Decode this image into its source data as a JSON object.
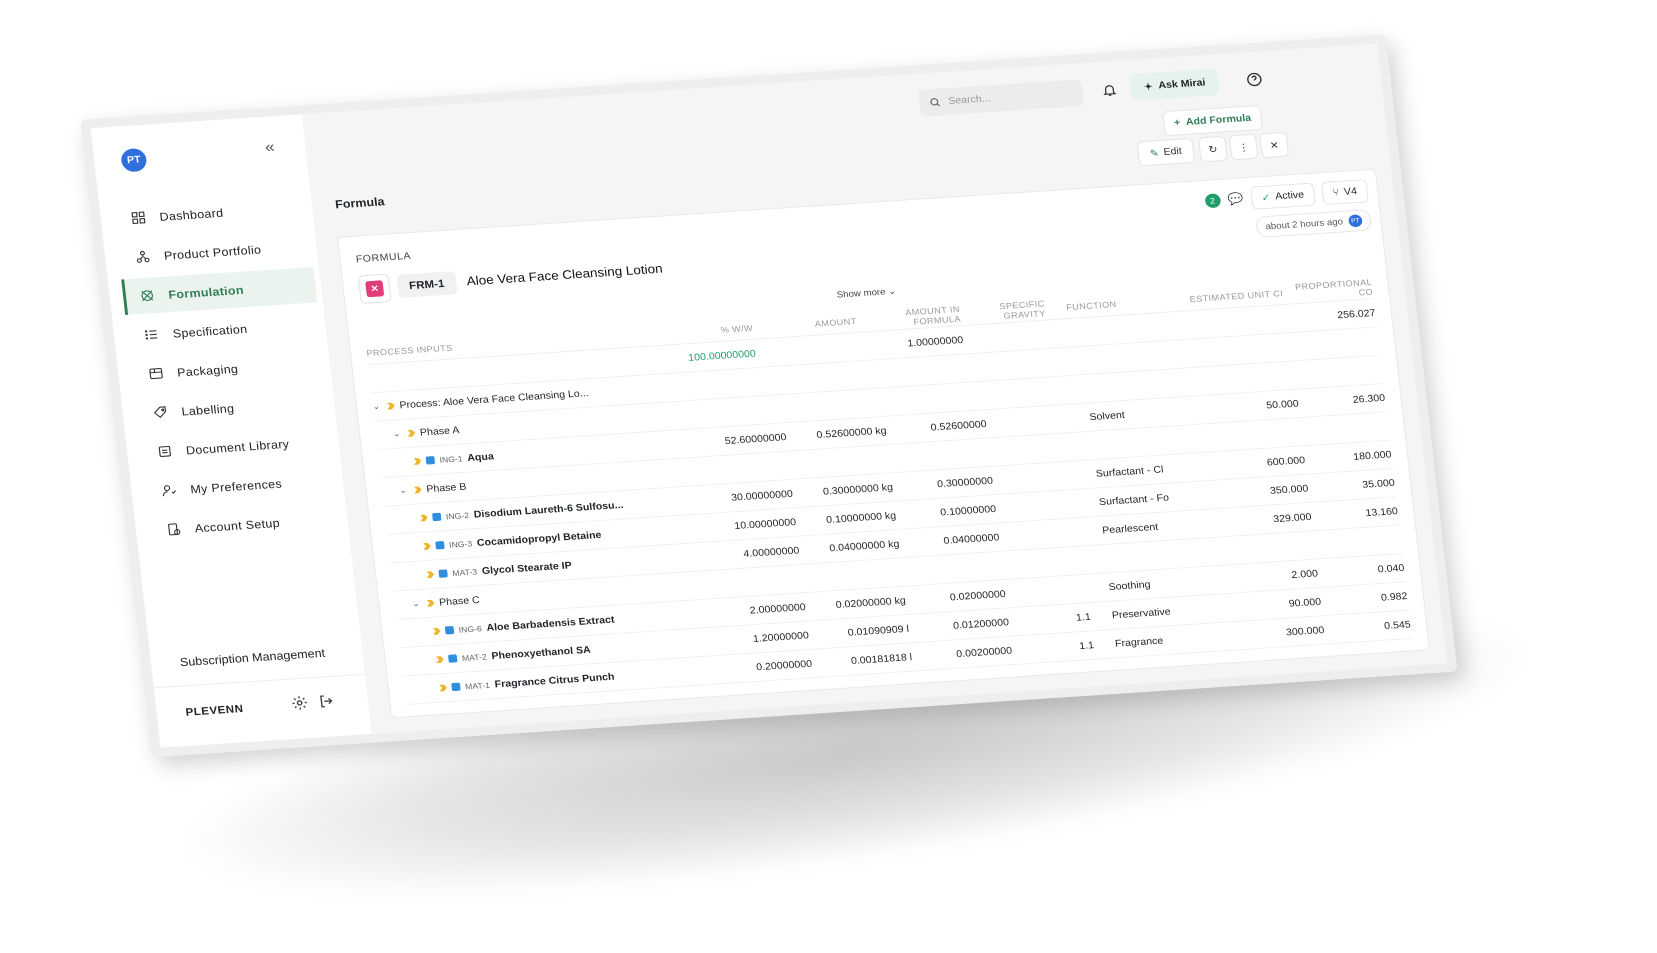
{
  "sidebar": {
    "avatar": "PT",
    "items": [
      {
        "label": "Dashboard",
        "icon": "dashboard-icon"
      },
      {
        "label": "Product Portfolio",
        "icon": "portfolio-icon"
      },
      {
        "label": "Formulation",
        "icon": "formulation-icon"
      },
      {
        "label": "Specification",
        "icon": "specification-icon"
      },
      {
        "label": "Packaging",
        "icon": "packaging-icon"
      },
      {
        "label": "Labelling",
        "icon": "label-icon"
      },
      {
        "label": "Document Library",
        "icon": "document-icon"
      },
      {
        "label": "My Preferences",
        "icon": "preferences-icon"
      },
      {
        "label": "Account Setup",
        "icon": "account-icon"
      }
    ],
    "active_index": 2,
    "subscription": "Subscription Management",
    "brand": "PLEVENN"
  },
  "topbar": {
    "search_placeholder": "Search...",
    "ask": "Ask Mirai",
    "add_formula": "Add Formula"
  },
  "main": {
    "title": "Formula",
    "edit": "Edit",
    "comments_count": "2",
    "status": "Active",
    "version": "V4",
    "updated": "about 2 hours ago",
    "updated_by": "PT",
    "section": "FORMULA",
    "code": "FRM-1",
    "name": "Aloe Vera Face Cleansing Lotion",
    "show_more": "Show more"
  },
  "table": {
    "headers": {
      "name": "PROCESS INPUTS",
      "pct": "% W/W",
      "amount": "AMOUNT",
      "aif": "AMOUNT IN FORMULA",
      "sg": "SPECIFIC GRAVITY",
      "fn": "FUNCTION",
      "euc": "ESTIMATED UNIT CI",
      "prop": "PROPORTIONAL CO"
    },
    "totals": {
      "pct": "100.00000000",
      "aif": "1.00000000",
      "prop": "256.027"
    },
    "rows": [
      {
        "level": 0,
        "kind": "process",
        "name": "Process: Aloe Vera Face Cleansing Lo...",
        "code": "",
        "pct": "",
        "amount": "",
        "aif": "",
        "sg": "",
        "fn": "",
        "euc": "",
        "prop": ""
      },
      {
        "level": 1,
        "kind": "phase",
        "name": "Phase A",
        "code": "",
        "pct": "",
        "amount": "",
        "aif": "",
        "sg": "",
        "fn": "",
        "euc": "",
        "prop": ""
      },
      {
        "level": 2,
        "kind": "ing",
        "name": "Aqua",
        "code": "ING-1",
        "pct": "52.60000000",
        "amount": "0.52600000 kg",
        "aif": "0.52600000",
        "sg": "",
        "fn": "Solvent",
        "euc": "50.000",
        "prop": "26.300"
      },
      {
        "level": 1,
        "kind": "phase",
        "name": "Phase B",
        "code": "",
        "pct": "",
        "amount": "",
        "aif": "",
        "sg": "",
        "fn": "",
        "euc": "",
        "prop": ""
      },
      {
        "level": 2,
        "kind": "ing",
        "name": "Disodium Laureth-6 Sulfosu...",
        "code": "ING-2",
        "pct": "30.00000000",
        "amount": "0.30000000 kg",
        "aif": "0.30000000",
        "sg": "",
        "fn": "Surfactant - Cl",
        "euc": "600.000",
        "prop": "180.000"
      },
      {
        "level": 2,
        "kind": "ing",
        "name": "Cocamidopropyl Betaine",
        "code": "ING-3",
        "pct": "10.00000000",
        "amount": "0.10000000 kg",
        "aif": "0.10000000",
        "sg": "",
        "fn": "Surfactant - Fo",
        "euc": "350.000",
        "prop": "35.000"
      },
      {
        "level": 2,
        "kind": "mat",
        "name": "Glycol Stearate IP",
        "code": "MAT-3",
        "pct": "4.00000000",
        "amount": "0.04000000 kg",
        "aif": "0.04000000",
        "sg": "",
        "fn": "Pearlescent",
        "euc": "329.000",
        "prop": "13.160"
      },
      {
        "level": 1,
        "kind": "phase",
        "name": "Phase C",
        "code": "",
        "pct": "",
        "amount": "",
        "aif": "",
        "sg": "",
        "fn": "",
        "euc": "",
        "prop": ""
      },
      {
        "level": 2,
        "kind": "ing",
        "name": "Aloe Barbadensis Extract",
        "code": "ING-6",
        "pct": "2.00000000",
        "amount": "0.02000000 kg",
        "aif": "0.02000000",
        "sg": "",
        "fn": "Soothing",
        "euc": "2.000",
        "prop": "0.040"
      },
      {
        "level": 2,
        "kind": "mat",
        "name": "Phenoxyethanol SA",
        "code": "MAT-2",
        "pct": "1.20000000",
        "amount": "0.01090909 l",
        "aif": "0.01200000",
        "sg": "1.1",
        "fn": "Preservative",
        "euc": "90.000",
        "prop": "0.982"
      },
      {
        "level": 2,
        "kind": "mat",
        "name": "Fragrance Citrus Punch",
        "code": "MAT-1",
        "pct": "0.20000000",
        "amount": "0.00181818 l",
        "aif": "0.00200000",
        "sg": "1.1",
        "fn": "Fragrance",
        "euc": "300.000",
        "prop": "0.545"
      }
    ]
  }
}
